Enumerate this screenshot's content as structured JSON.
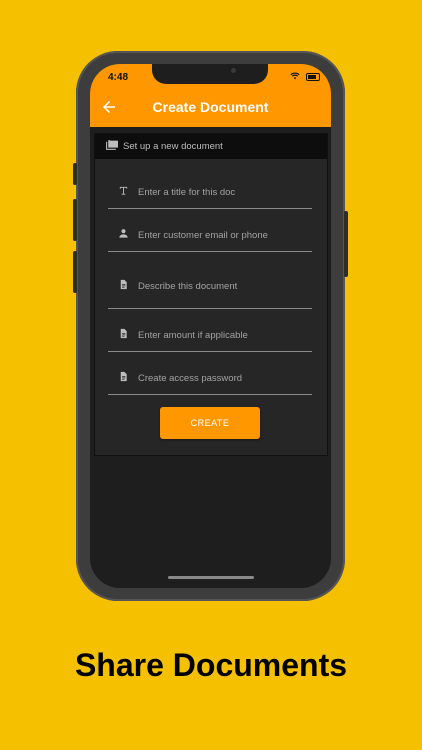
{
  "status": {
    "time": "4:48"
  },
  "appbar": {
    "title": "Create Document"
  },
  "card": {
    "header": "Set up a new document"
  },
  "form": {
    "title_placeholder": "Enter a title for this doc",
    "customer_placeholder": "Enter customer email or phone",
    "description_placeholder": "Describe this document",
    "amount_placeholder": "Enter amount if applicable",
    "password_placeholder": "Create access password",
    "create_label": "CREATE"
  },
  "caption": "Share Documents",
  "colors": {
    "background": "#f5c000",
    "accent": "#ff9800",
    "surface": "#262626",
    "text_on_accent": "#ffffff"
  },
  "icons": {
    "back": "arrow-left-icon",
    "header": "folders-icon",
    "title": "text-format-icon",
    "customer": "person-icon",
    "document": "document-icon"
  }
}
